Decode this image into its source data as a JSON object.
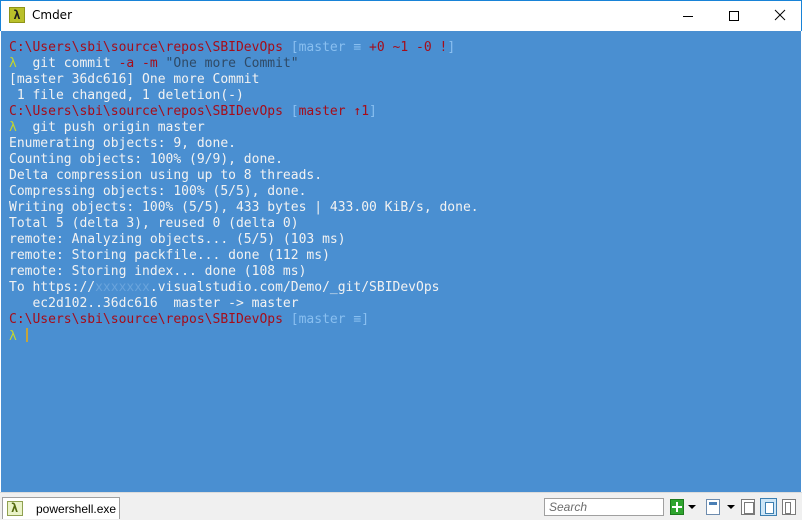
{
  "window": {
    "title": "Cmder",
    "app_icon": "λ",
    "buttons": {
      "minimize": "minimize-icon",
      "maximize": "maximize-icon",
      "close": "close-icon"
    }
  },
  "console": {
    "lines": [
      {
        "segments": [
          {
            "t": "C:\\Users\\sbi\\source\\repos\\SBIDevOps ",
            "c": "red"
          },
          {
            "t": "[",
            "c": "ghost"
          },
          {
            "t": "master ≡ ",
            "c": "ghost"
          },
          {
            "t": "+0 ~1 -0 !",
            "c": "red"
          },
          {
            "t": "]",
            "c": "ghost"
          }
        ]
      },
      {
        "segments": [
          {
            "t": "λ ",
            "c": "lambda"
          },
          {
            "t": " git commit ",
            "c": "text"
          },
          {
            "t": "-a -m ",
            "c": "param"
          },
          {
            "t": "\"One more Commit\"",
            "c": "str"
          }
        ]
      },
      {
        "segments": [
          {
            "t": "[master 36dc616] One more Commit",
            "c": "text"
          }
        ]
      },
      {
        "segments": [
          {
            "t": " 1 file changed, 1 deletion(-)",
            "c": "text"
          }
        ]
      },
      {
        "segments": [
          {
            "t": "C:\\Users\\sbi\\source\\repos\\SBIDevOps ",
            "c": "red"
          },
          {
            "t": "[",
            "c": "ghost"
          },
          {
            "t": "master ↑1",
            "c": "red"
          },
          {
            "t": "]",
            "c": "ghost"
          }
        ]
      },
      {
        "segments": [
          {
            "t": "λ ",
            "c": "lambda"
          },
          {
            "t": " git push origin master",
            "c": "text"
          }
        ]
      },
      {
        "segments": [
          {
            "t": "Enumerating objects: 9, done.",
            "c": "text"
          }
        ]
      },
      {
        "segments": [
          {
            "t": "Counting objects: 100% (9/9), done.",
            "c": "text"
          }
        ]
      },
      {
        "segments": [
          {
            "t": "Delta compression using up to 8 threads.",
            "c": "text"
          }
        ]
      },
      {
        "segments": [
          {
            "t": "Compressing objects: 100% (5/5), done.",
            "c": "text"
          }
        ]
      },
      {
        "segments": [
          {
            "t": "Writing objects: 100% (5/5), 433 bytes | 433.00 KiB/s, done.",
            "c": "text"
          }
        ]
      },
      {
        "segments": [
          {
            "t": "Total 5 (delta 3), reused 0 (delta 0)",
            "c": "text"
          }
        ]
      },
      {
        "segments": [
          {
            "t": "remote: Analyzing objects... (5/5) (103 ms)",
            "c": "text"
          }
        ]
      },
      {
        "segments": [
          {
            "t": "remote: Storing packfile... done (112 ms)",
            "c": "text"
          }
        ]
      },
      {
        "segments": [
          {
            "t": "remote: Storing index... done (108 ms)",
            "c": "text"
          }
        ]
      },
      {
        "segments": [
          {
            "t": "To https://",
            "c": "text"
          },
          {
            "t": "xxxxxxx",
            "c": "blur"
          },
          {
            "t": ".visualstudio.com/Demo/_git/SBIDevOps",
            "c": "text"
          }
        ]
      },
      {
        "segments": [
          {
            "t": "   ec2d102..36dc616  master -> master",
            "c": "text"
          }
        ]
      },
      {
        "segments": [
          {
            "t": "C:\\Users\\sbi\\source\\repos\\SBIDevOps ",
            "c": "red"
          },
          {
            "t": "[",
            "c": "ghost"
          },
          {
            "t": "master ≡",
            "c": "ghost"
          },
          {
            "t": "]",
            "c": "ghost"
          }
        ]
      },
      {
        "segments": [
          {
            "t": "λ ",
            "c": "lambda"
          }
        ],
        "cursor": true
      }
    ]
  },
  "statusbar": {
    "tab_label": "powershell.exe",
    "search_placeholder": "Search",
    "icons": [
      "new-console-icon",
      "dropdown-arrow-icon",
      "window-icon",
      "dropdown-arrow-icon",
      "split-view-icon",
      "single-view-icon",
      "panel-view-icon"
    ]
  },
  "colors": {
    "console_bg": "#4a8fd1",
    "prompt_path": "#a50d1a",
    "lambda": "#c6d62b",
    "text": "#f2f2f2",
    "ghost": "#89bff0"
  }
}
